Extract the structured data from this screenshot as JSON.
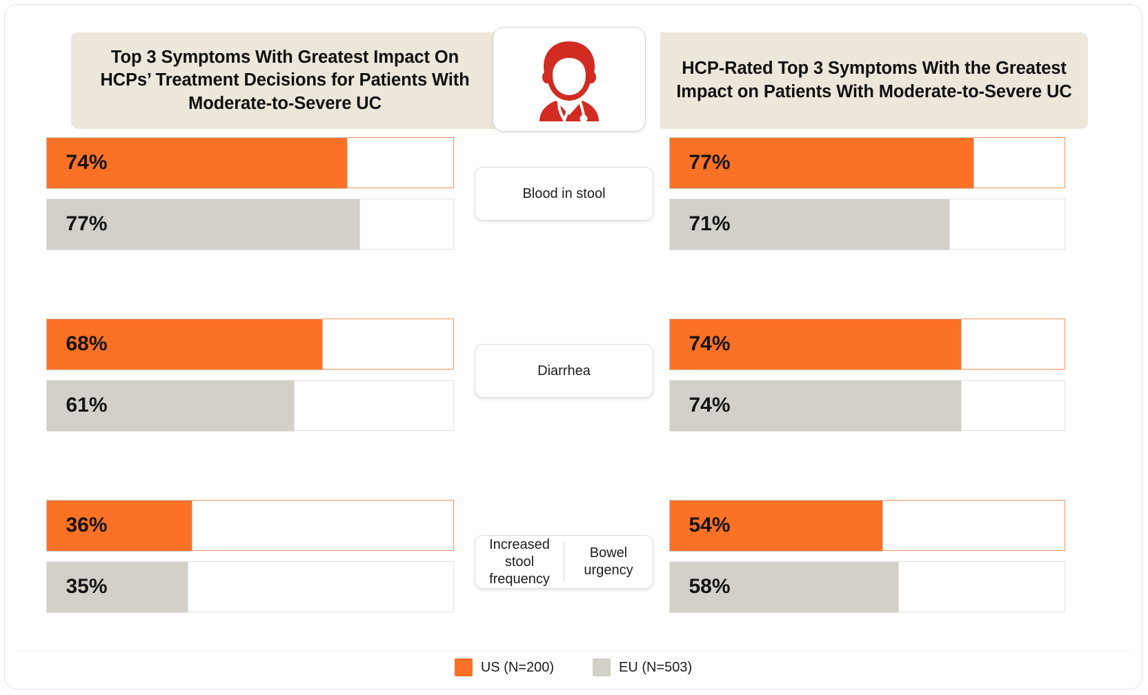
{
  "titles": {
    "left": "Top 3 Symptoms With Greatest Impact On HCPs’ Treatment Decisions for Patients With Moderate-to-Severe UC",
    "right": "HCP-Rated Top 3 Symptoms With the Greatest Impact on Patients With Moderate-to-Severe UC"
  },
  "center_icon": "doctor-icon",
  "symptom_labels": [
    {
      "single": "Blood in stool"
    },
    {
      "single": "Diarrhea"
    },
    {
      "left": "Increased stool frequency",
      "right": "Bowel urgency"
    }
  ],
  "legend": {
    "items": [
      {
        "name": "US",
        "label": "US (N=200)",
        "color": "#FB7125"
      },
      {
        "name": "EU",
        "label": "EU (N=503)",
        "color": "#D2D0C8"
      }
    ]
  },
  "colors": {
    "us_fill": "#FB7125",
    "us_track_border": "#F7915A",
    "eu_fill": "#D2D0C8",
    "eu_track_border": "#E2E1DC",
    "banner_bg": "#EDE6DA",
    "icon_red": "#D22B22"
  },
  "chart_data": [
    {
      "type": "bar",
      "orientation": "horizontal",
      "title": "Top 3 Symptoms With Greatest Impact On HCPs’ Treatment Decisions for Patients With Moderate-to-Severe UC",
      "panel": "left",
      "categories": [
        "Blood in stool",
        "Diarrhea",
        "Increased stool frequency"
      ],
      "series": [
        {
          "name": "US (N=200)",
          "color": "#FB7125",
          "values": [
            74,
            68,
            36
          ]
        },
        {
          "name": "EU (N=503)",
          "color": "#D2D0C8",
          "values": [
            77,
            61,
            35
          ]
        }
      ],
      "value_labels": [
        [
          "74%",
          "68%",
          "36%"
        ],
        [
          "77%",
          "61%",
          "35%"
        ]
      ],
      "xlim": [
        0,
        100
      ],
      "xlabel": "",
      "ylabel": "",
      "grid": false,
      "legend_position": "bottom"
    },
    {
      "type": "bar",
      "orientation": "horizontal",
      "title": "HCP-Rated Top 3 Symptoms With the Greatest Impact on Patients With Moderate-to-Severe UC",
      "panel": "right",
      "categories": [
        "Blood in stool",
        "Diarrhea",
        "Bowel urgency"
      ],
      "series": [
        {
          "name": "US (N=200)",
          "color": "#FB7125",
          "values": [
            77,
            74,
            54
          ]
        },
        {
          "name": "EU (N=503)",
          "color": "#D2D0C8",
          "values": [
            71,
            74,
            58
          ]
        }
      ],
      "value_labels": [
        [
          "77%",
          "74%",
          "54%"
        ],
        [
          "71%",
          "74%",
          "58%"
        ]
      ],
      "xlim": [
        0,
        100
      ],
      "xlabel": "",
      "ylabel": "",
      "grid": false,
      "legend_position": "bottom"
    }
  ]
}
